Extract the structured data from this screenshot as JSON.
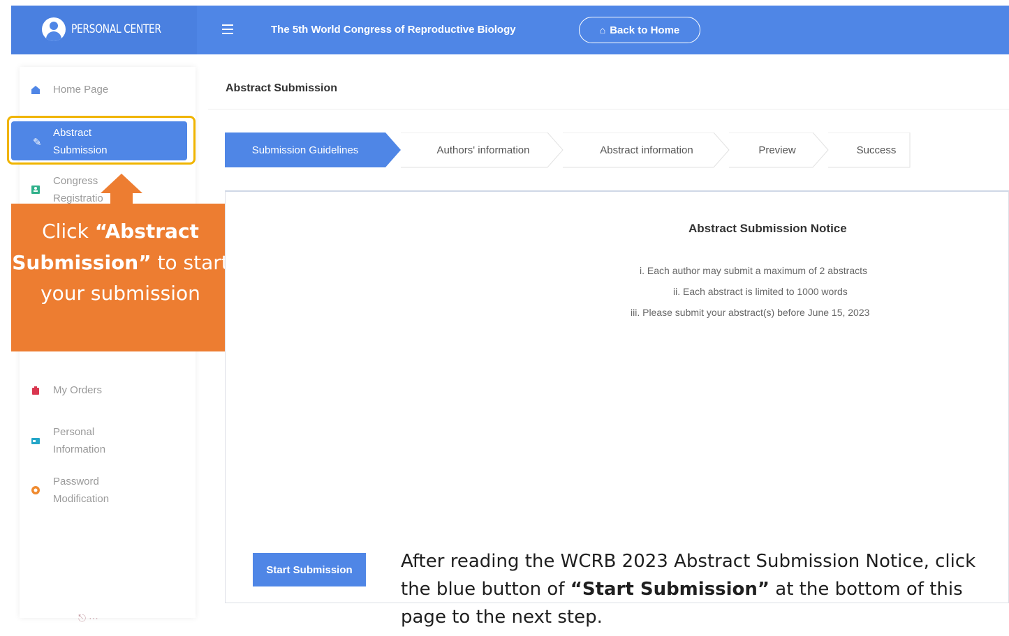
{
  "header": {
    "brand": "PERSONAL CENTER",
    "conference_title": "The 5th World Congress of Reproductive Biology",
    "back_home": "Back to Home",
    "accent_color": "#4f86e6"
  },
  "sidebar": {
    "items": [
      {
        "label": "Home Page",
        "icon": "home-icon"
      },
      {
        "label": "Abstract Submission",
        "icon": "edit-icon",
        "active": true
      },
      {
        "label": "Congress Registration",
        "icon": "registration-icon"
      },
      {
        "label": "My Orders",
        "icon": "orders-icon"
      },
      {
        "label": "Personal Information",
        "icon": "id-card-icon"
      },
      {
        "label": "Password Modification",
        "icon": "lock-icon"
      }
    ],
    "active_line1": "Abstract",
    "active_line2": "Submission",
    "congress_line1": "Congress",
    "congress_line2": "Registratio",
    "personal_line1": "Personal",
    "personal_line2": "Information",
    "password_line1": "Password",
    "password_line2": "Modification"
  },
  "callout": {
    "prefix": "Click ",
    "bold": "“Abstract Submission”",
    "suffix": " to start your submission",
    "color": "#ed7d31"
  },
  "main": {
    "title": "Abstract Submission",
    "steps": [
      "Submission Guidelines",
      "Authors' information",
      "Abstract information",
      "Preview",
      "Success"
    ],
    "notice": {
      "title": "Abstract Submission Notice",
      "lines": [
        "i. Each author may submit a maximum of 2 abstracts",
        "ii. Each abstract is limited to 1000 words",
        "iii. Please submit your abstract(s) before June 15, 2023"
      ]
    },
    "start_button": "Start Submission"
  },
  "instruction": {
    "part1": "After reading the WCRB 2023 Abstract Submission Notice, click the blue button of ",
    "bold": "“Start Submission”",
    "part2": " at the bottom of this page to the next step."
  }
}
